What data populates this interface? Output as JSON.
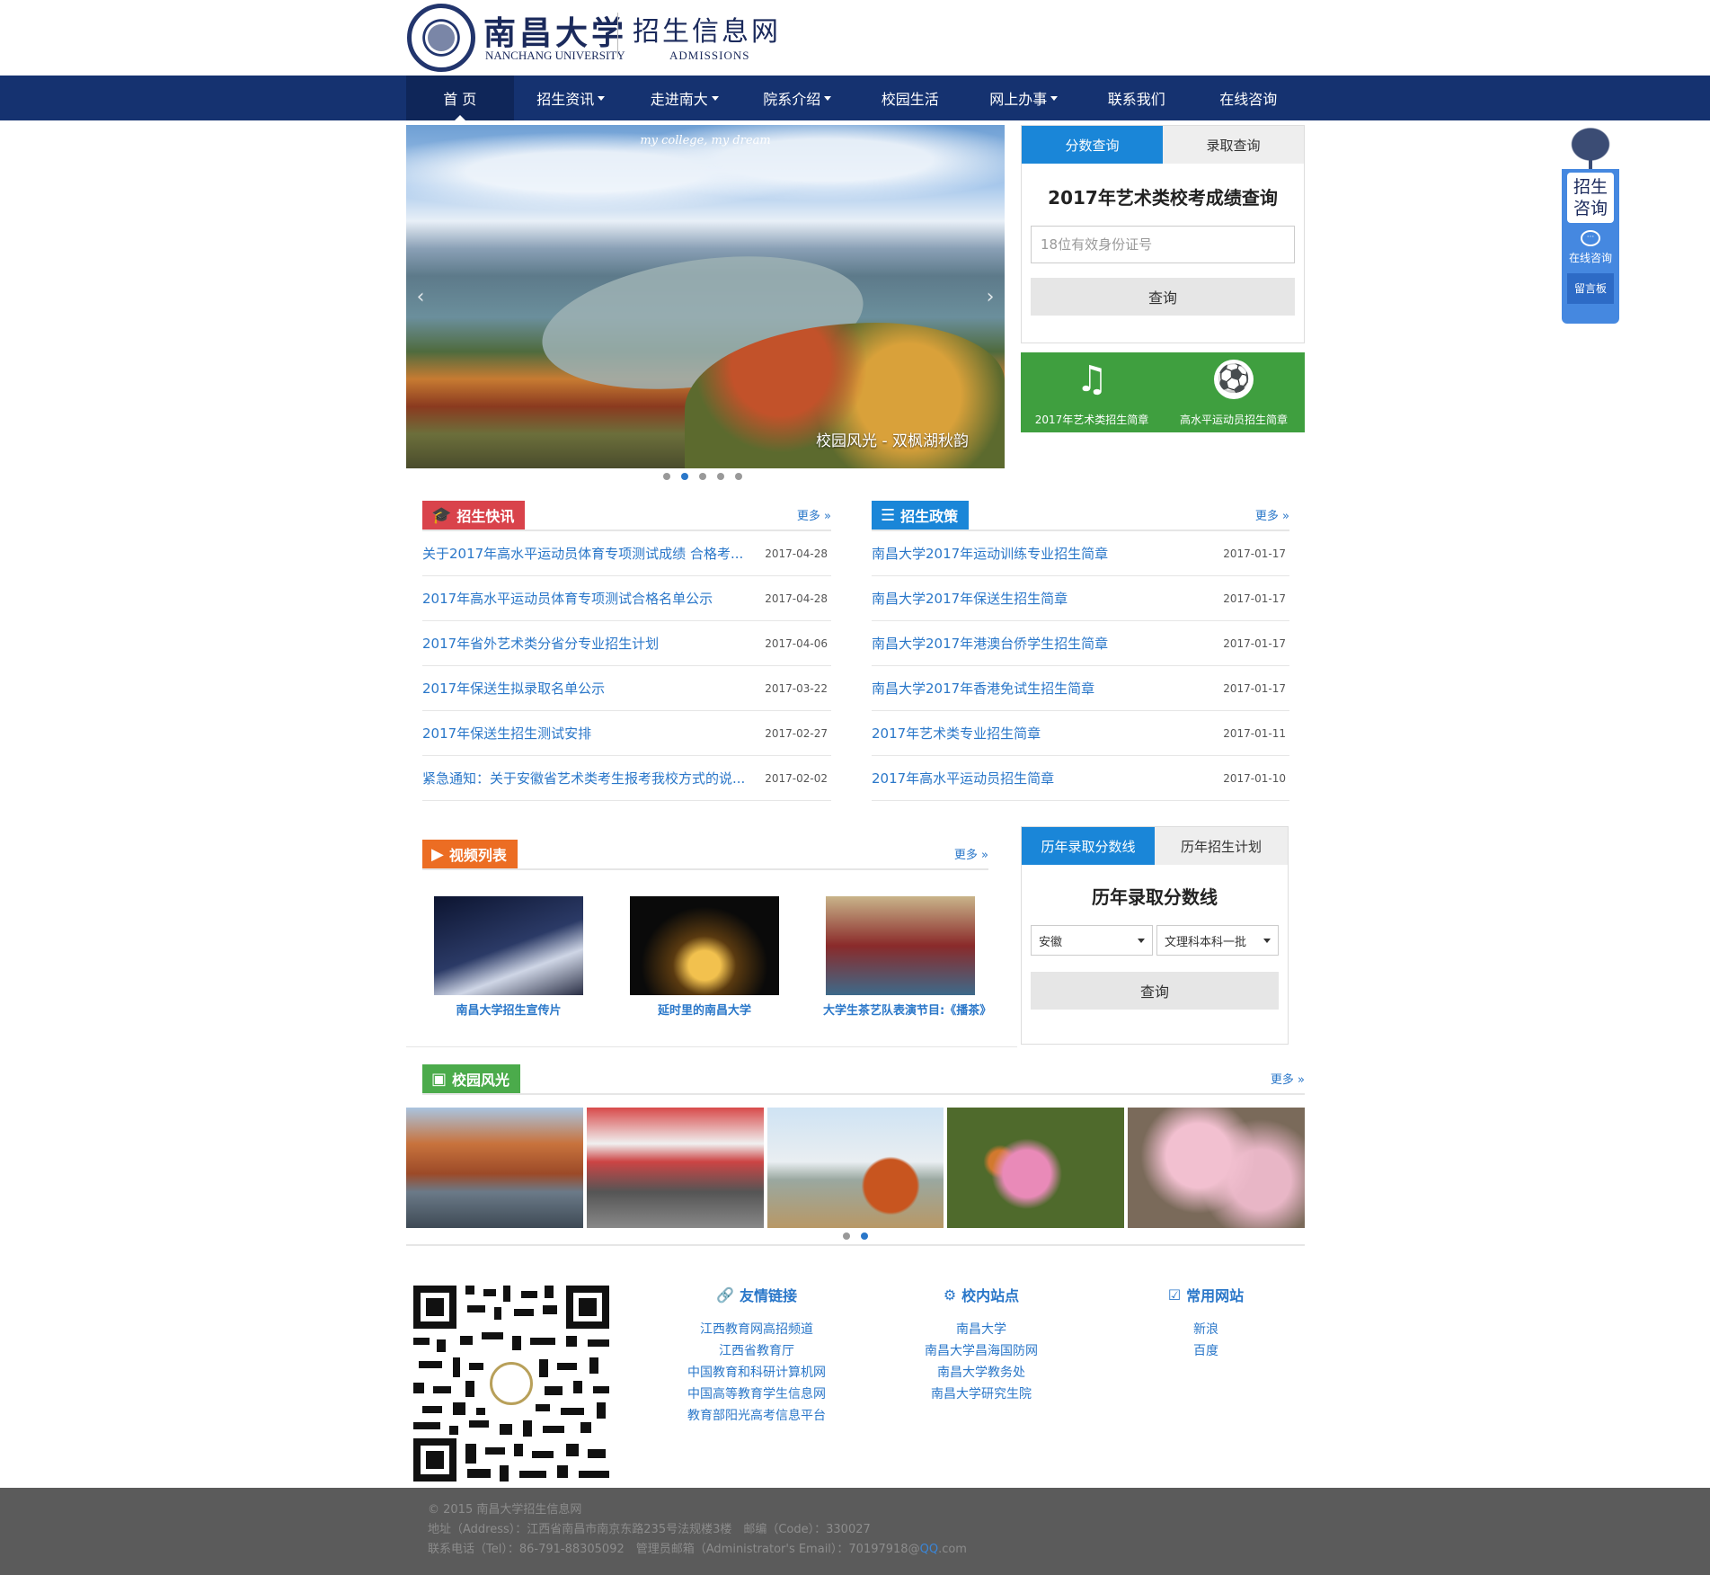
{
  "header": {
    "logo_cn": "南昌大学",
    "logo_en": "NANCHANG UNIVERSITY",
    "site_name": "招生信息网",
    "site_en": "ADMISSIONS"
  },
  "nav": {
    "items": [
      {
        "label": "首 页",
        "dropdown": false,
        "active": true
      },
      {
        "label": "招生资讯",
        "dropdown": true
      },
      {
        "label": "走进南大",
        "dropdown": true
      },
      {
        "label": "院系介绍",
        "dropdown": true
      },
      {
        "label": "校园生活",
        "dropdown": false
      },
      {
        "label": "网上办事",
        "dropdown": true
      },
      {
        "label": "联系我们",
        "dropdown": false
      },
      {
        "label": "在线咨询",
        "dropdown": false
      }
    ]
  },
  "slider": {
    "motto": "my college, my dream",
    "caption": "校园风光 - 双枫湖秋韵",
    "active_slide": 2,
    "slide_count": 5
  },
  "score_query": {
    "tabs": [
      "分数查询",
      "录取查询"
    ],
    "title": "2017年艺术类校考成绩查询",
    "placeholder": "18位有效身份证号",
    "button": "查询"
  },
  "brochures": [
    {
      "label": "2017年艺术类招生简章",
      "icon": "music-note-icon"
    },
    {
      "label": "高水平运动员招生简章",
      "icon": "soccer-ball-icon"
    }
  ],
  "news": {
    "title": "招生快讯",
    "more": "更多 »",
    "color": "#d9434b",
    "items": [
      {
        "title": "关于2017年高水平运动员体育专项测试成绩 合格考...",
        "date": "2017-04-28"
      },
      {
        "title": "2017年高水平运动员体育专项测试合格名单公示",
        "date": "2017-04-28"
      },
      {
        "title": "2017年省外艺术类分省分专业招生计划",
        "date": "2017-04-06"
      },
      {
        "title": "2017年保送生拟录取名单公示",
        "date": "2017-03-22"
      },
      {
        "title": "2017年保送生招生测试安排",
        "date": "2017-02-27"
      },
      {
        "title": "紧急通知：关于安徽省艺术类考生报考我校方式的说...",
        "date": "2017-02-02"
      }
    ]
  },
  "policy": {
    "title": "招生政策",
    "more": "更多 »",
    "color": "#1a86d8",
    "items": [
      {
        "title": "南昌大学2017年运动训练专业招生简章",
        "date": "2017-01-17"
      },
      {
        "title": "南昌大学2017年保送生招生简章",
        "date": "2017-01-17"
      },
      {
        "title": "南昌大学2017年港澳台侨学生招生简章",
        "date": "2017-01-17"
      },
      {
        "title": "南昌大学2017年香港免试生招生简章",
        "date": "2017-01-17"
      },
      {
        "title": "2017年艺术类专业招生简章",
        "date": "2017-01-11"
      },
      {
        "title": "2017年高水平运动员招生简章",
        "date": "2017-01-10"
      }
    ]
  },
  "videos": {
    "title": "视频列表",
    "more": "更多 »",
    "color": "#ec6d23",
    "items": [
      {
        "label": "南昌大学招生宣传片"
      },
      {
        "label": "延时里的南昌大学"
      },
      {
        "label": "大学生茶艺队表演节目:《播茶》"
      }
    ]
  },
  "cutoff": {
    "tabs": [
      "历年录取分数线",
      "历年招生计划"
    ],
    "title": "历年录取分数线",
    "province": "安徽",
    "category": "文理科本科一批",
    "button": "查询"
  },
  "campus": {
    "title": "校园风光",
    "more": "更多 »",
    "color": "#4bab4b",
    "active_page": 2,
    "page_count": 2
  },
  "links": {
    "friend": {
      "title": "友情链接",
      "items": [
        "江西教育网高招频道",
        "江西省教育厅",
        "中国教育和科研计算机网",
        "中国高等教育学生信息网",
        "教育部阳光高考信息平台"
      ]
    },
    "internal": {
      "title": "校内站点",
      "items": [
        "南昌大学",
        "南昌大学昌海国防网",
        "南昌大学教务处",
        "南昌大学研究生院"
      ]
    },
    "common": {
      "title": "常用网站",
      "items": [
        "新浪",
        "百度"
      ]
    }
  },
  "footer": {
    "copyright": "© 2015 南昌大学招生信息网",
    "address": "地址（Address）：江西省南昌市南京东路235号法规楼3楼　邮编（Code）：330027",
    "contact_prefix": "联系电话（Tel）：86-791-88305092　管理员邮箱（Administrator's Email）：70197918@",
    "qq": "QQ",
    "com": ".com"
  },
  "float_panel": {
    "consult": "招生咨询",
    "chat": "在线咨询",
    "message": "留言板"
  }
}
